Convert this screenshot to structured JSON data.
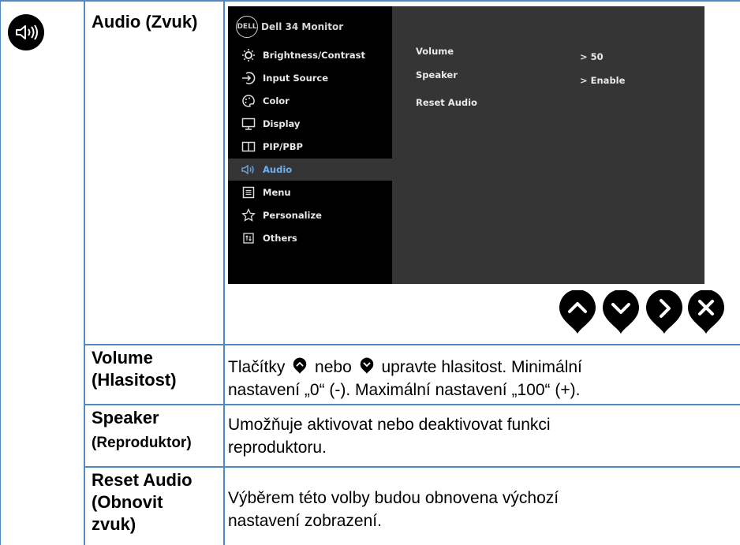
{
  "section": {
    "title": "Audio (Zvuk)",
    "icon": "speaker-icon"
  },
  "osd": {
    "title": "Dell 34 Monitor",
    "logo_text": "DELL",
    "menu": [
      {
        "label": "Brightness/Contrast",
        "icon": "brightness-icon"
      },
      {
        "label": "Input Source",
        "icon": "input-source-icon"
      },
      {
        "label": "Color",
        "icon": "color-palette-icon"
      },
      {
        "label": "Display",
        "icon": "display-icon"
      },
      {
        "label": "PIP/PBP",
        "icon": "pip-pbp-icon"
      },
      {
        "label": "Audio",
        "icon": "speaker-icon",
        "active": true
      },
      {
        "label": "Menu",
        "icon": "menu-icon"
      },
      {
        "label": "Personalize",
        "icon": "star-icon"
      },
      {
        "label": "Others",
        "icon": "others-icon"
      }
    ],
    "options": [
      {
        "label": "Volume",
        "value": "> 50"
      },
      {
        "label": "Speaker",
        "value": "> Enable"
      },
      {
        "label": "Reset Audio",
        "value": ""
      }
    ],
    "accent": "#6fb1f0"
  },
  "nav_buttons": [
    "up-arrow-icon",
    "down-arrow-icon",
    "right-arrow-icon",
    "close-icon"
  ],
  "rows": [
    {
      "label_line1": "Volume",
      "label_line2": "(Hlasitost)",
      "desc_prefix": "Tlačítky",
      "desc_mid": "nebo",
      "desc_suffix": "upravte hlasitost. Minimální",
      "desc_line2": "nastavení „0“ (-). Maximální nastavení „100“ (+)."
    },
    {
      "label_line1": "Speaker",
      "label_line2": "(Reproduktor)",
      "desc_line1": "Umožňuje aktivovat nebo deaktivovat funkci",
      "desc_line2": "reproduktoru."
    },
    {
      "label_line1": "Reset Audio",
      "label_line2": "(Obnovit",
      "label_line3": "zvuk)",
      "desc_line1": "Výběrem této volby budou obnovena výchozí",
      "desc_line2": "nastavení zobrazení."
    }
  ],
  "frame_color": "#4e8bc4"
}
